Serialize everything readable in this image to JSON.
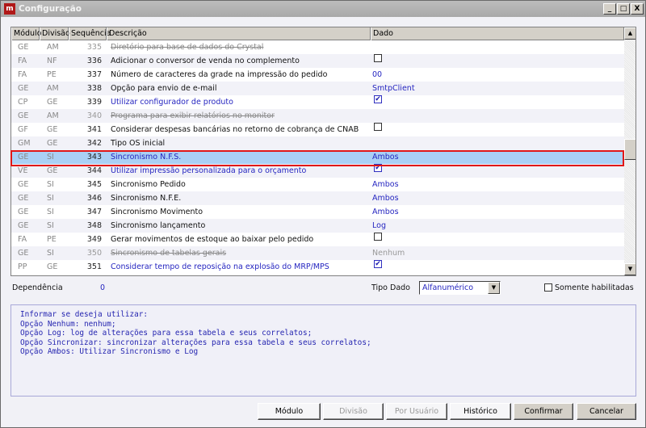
{
  "window": {
    "title": "Configuração",
    "logo": "m",
    "minimize": "_",
    "maximize": "□",
    "close": "X"
  },
  "grid": {
    "columns": [
      "Módulo",
      "Divisão",
      "Sequência",
      "Descrição",
      "Dado"
    ],
    "rows": [
      {
        "modulo": "GE",
        "divisao": "AM",
        "seq": "335",
        "desc": "Diretório para base de dados do Crystal",
        "style": "strike",
        "dado": "",
        "dado_type": "text"
      },
      {
        "modulo": "FA",
        "divisao": "NF",
        "seq": "336",
        "desc": "Adicionar o conversor de venda no complemento",
        "style": "normal",
        "dado": "",
        "dado_type": "checkbox",
        "checked": false
      },
      {
        "modulo": "FA",
        "divisao": "PE",
        "seq": "337",
        "desc": "Número de caracteres da grade na impressão do pedido",
        "style": "normal",
        "dado": "00",
        "dado_type": "text"
      },
      {
        "modulo": "GE",
        "divisao": "AM",
        "seq": "338",
        "desc": "Opção para envio de e-mail",
        "style": "normal",
        "dado": "SmtpClient",
        "dado_type": "text"
      },
      {
        "modulo": "CP",
        "divisao": "GE",
        "seq": "339",
        "desc": "Utilizar configurador de produto",
        "style": "blue",
        "dado": "",
        "dado_type": "checkbox",
        "checked": true
      },
      {
        "modulo": "GE",
        "divisao": "AM",
        "seq": "340",
        "desc": "Programa para exibir relatórios no monitor",
        "style": "strike",
        "dado": "",
        "dado_type": "text"
      },
      {
        "modulo": "GF",
        "divisao": "GE",
        "seq": "341",
        "desc": "Considerar despesas bancárias no retorno de cobrança de CNAB",
        "style": "normal",
        "dado": "",
        "dado_type": "checkbox",
        "checked": false
      },
      {
        "modulo": "GM",
        "divisao": "GE",
        "seq": "342",
        "desc": "Tipo OS inicial",
        "style": "normal",
        "dado": "",
        "dado_type": "text"
      },
      {
        "modulo": "GE",
        "divisao": "SI",
        "seq": "343",
        "desc": "Sincronismo N.F.S.",
        "style": "sel",
        "dado": "Ambos",
        "dado_type": "text"
      },
      {
        "modulo": "VE",
        "divisao": "GE",
        "seq": "344",
        "desc": "Utilizar impressão personalizada para o orçamento",
        "style": "blue",
        "dado": "",
        "dado_type": "checkbox",
        "checked": true
      },
      {
        "modulo": "GE",
        "divisao": "SI",
        "seq": "345",
        "desc": "Sincronismo Pedido",
        "style": "normal",
        "dado": "Ambos",
        "dado_type": "text"
      },
      {
        "modulo": "GE",
        "divisao": "SI",
        "seq": "346",
        "desc": "Sincronismo N.F.E.",
        "style": "normal",
        "dado": "Ambos",
        "dado_type": "text"
      },
      {
        "modulo": "GE",
        "divisao": "SI",
        "seq": "347",
        "desc": "Sincronismo Movimento",
        "style": "normal",
        "dado": "Ambos",
        "dado_type": "text"
      },
      {
        "modulo": "GE",
        "divisao": "SI",
        "seq": "348",
        "desc": "Sincronismo lançamento",
        "style": "normal",
        "dado": "Log",
        "dado_type": "text"
      },
      {
        "modulo": "FA",
        "divisao": "PE",
        "seq": "349",
        "desc": "Gerar movimentos de estoque ao baixar pelo pedido",
        "style": "normal",
        "dado": "",
        "dado_type": "checkbox",
        "checked": false
      },
      {
        "modulo": "GE",
        "divisao": "SI",
        "seq": "350",
        "desc": "Sincronismo de tabelas gerais",
        "style": "strike",
        "dado": "Nenhum",
        "dado_type": "text"
      },
      {
        "modulo": "PP",
        "divisao": "GE",
        "seq": "351",
        "desc": "Considerar tempo de reposição na explosão do MRP/MPS",
        "style": "blue",
        "dado": "",
        "dado_type": "checkbox",
        "checked": true
      }
    ]
  },
  "filters": {
    "dependencia_label": "Dependência",
    "dependencia_value": "0",
    "tipo_dado_label": "Tipo Dado",
    "tipo_dado_value": "Alfanumérico",
    "somente_label": "Somente habilitadas"
  },
  "description": "Informar se deseja utilizar:\nOpção Nenhum: nenhum;\nOpção Log: log de alterações para essa tabela e seus correlatos;\nOpção Sincronizar: sincronizar alterações para essa tabela e seus correlatos;\nOpção Ambos: Utilizar Sincronismo e Log",
  "buttons": {
    "modulo": "Módulo",
    "divisao": "Divisão",
    "por_usuario": "Por Usuário",
    "historico": "Histórico",
    "confirmar": "Confirmar",
    "cancelar": "Cancelar"
  }
}
